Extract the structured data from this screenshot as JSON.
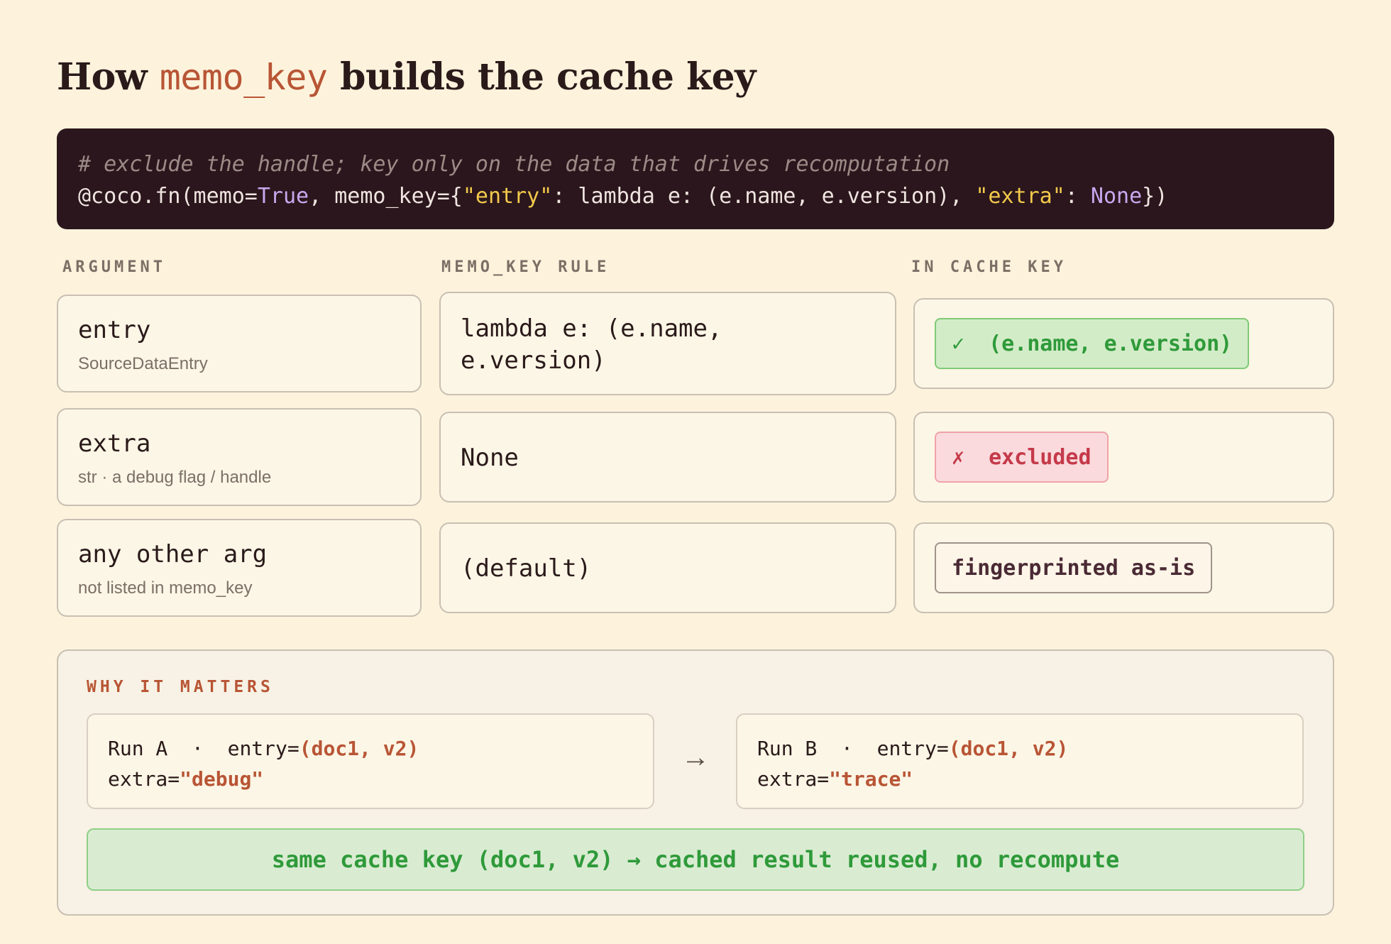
{
  "title": {
    "prefix": "How",
    "code": "memo_key",
    "suffix": "builds the cache key"
  },
  "code_block": {
    "comment": "# exclude the handle; key only on the data that drives recomputation",
    "line": {
      "p1": "@coco.fn(memo=",
      "kw1": "True",
      "p2": ", memo_key={",
      "s1": "\"entry\"",
      "p3": ": lambda e: (e.name, e.version), ",
      "s2": "\"extra\"",
      "p4": ": ",
      "kw2": "None",
      "p5": "})"
    }
  },
  "columns": {
    "argument": "ARGUMENT",
    "rule": "MEMO_KEY RULE",
    "in_cache_key": "IN CACHE KEY"
  },
  "rows": [
    {
      "arg": "entry",
      "type": "SourceDataEntry",
      "rule_line1": "lambda e: (e.name,",
      "rule_line2": "e.version)",
      "result_mark": "✓",
      "result_text": "(e.name, e.version)",
      "result_status": "included"
    },
    {
      "arg": "extra",
      "type": "str · a debug flag / handle",
      "rule_line1": "None",
      "result_mark": "✗",
      "result_text": "excluded",
      "result_status": "excluded"
    },
    {
      "arg": "any other arg",
      "type": "not listed in memo_key",
      "rule_line1": "(default)",
      "result_text": "fingerprinted as-is",
      "result_status": "default"
    }
  ],
  "why": {
    "heading": "WHY IT MATTERS",
    "run_a": {
      "label": "Run A",
      "sep": "·",
      "entry_key": "entry=",
      "entry_val": "(doc1, v2)",
      "extra_key": "extra=",
      "extra_val": "\"debug\""
    },
    "arrow": "→",
    "run_b": {
      "label": "Run B",
      "sep": "·",
      "entry_key": "entry=",
      "entry_val": "(doc1, v2)",
      "extra_key": "extra=",
      "extra_val": "\"trace\""
    },
    "result": "same cache key (doc1, v2) → cached result reused, no recompute"
  },
  "colors": {
    "background": "#fdf3dc",
    "accent": "#b85535",
    "code_bg": "#2a161c",
    "included": "#2f9a3a",
    "excluded": "#c53a4a"
  }
}
